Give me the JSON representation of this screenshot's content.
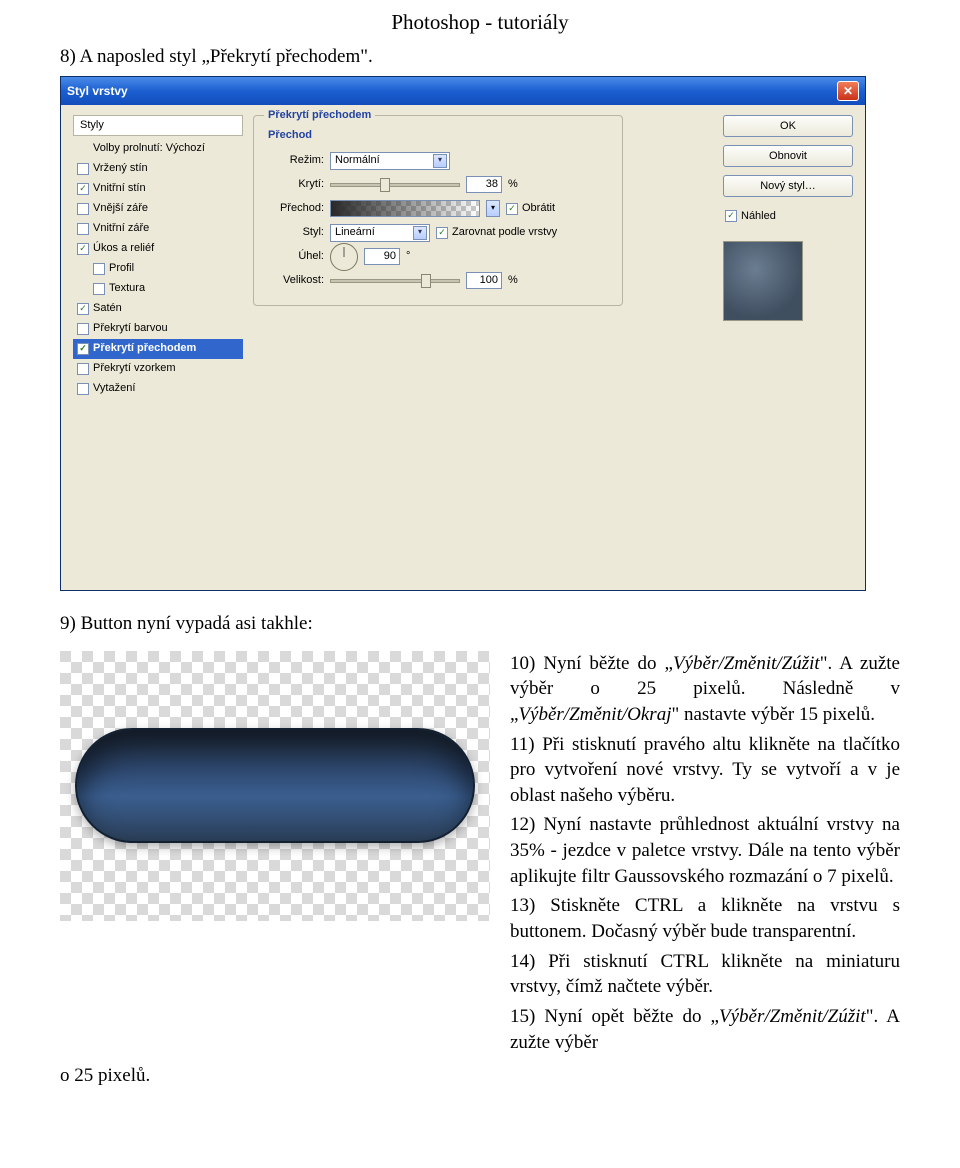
{
  "header": {
    "title": "Photoshop - tutoriály"
  },
  "step8": "8)  A naposled styl „Překrytí přechodem\".",
  "dialog": {
    "title": "Styl vrstvy",
    "left": {
      "header": "Styly",
      "items": [
        {
          "label": "Volby prolnutí: Výchozí",
          "checked": null
        },
        {
          "label": "Vržený stín",
          "checked": false
        },
        {
          "label": "Vnitřní stín",
          "checked": true
        },
        {
          "label": "Vnější záře",
          "checked": false
        },
        {
          "label": "Vnitřní záře",
          "checked": false
        },
        {
          "label": "Úkos a reliéf",
          "checked": true
        },
        {
          "label": "Profil",
          "checked": false,
          "sub": true
        },
        {
          "label": "Textura",
          "checked": false,
          "sub": true
        },
        {
          "label": "Satén",
          "checked": true
        },
        {
          "label": "Překrytí barvou",
          "checked": false
        },
        {
          "label": "Překrytí přechodem",
          "checked": true,
          "selected": true
        },
        {
          "label": "Překrytí vzorkem",
          "checked": false
        },
        {
          "label": "Vytažení",
          "checked": false
        }
      ]
    },
    "mid": {
      "fs_title": "Překrytí přechodem",
      "sub_title": "Přechod",
      "mode_label": "Režim:",
      "mode_value": "Normální",
      "opacity_label": "Krytí:",
      "opacity_value": "38",
      "pct": "%",
      "gradient_label": "Přechod:",
      "invert_label": "Obrátit",
      "style_label": "Styl:",
      "style_value": "Lineární",
      "align_label": "Zarovnat podle vrstvy",
      "angle_label": "Úhel:",
      "angle_value": "90",
      "angle_deg": "°",
      "size_label": "Velikost:",
      "size_value": "100",
      "size_pct": "%"
    },
    "right": {
      "ok": "OK",
      "cancel": "Obnovit",
      "new_style": "Nový styl…",
      "preview_label": "Náhled"
    }
  },
  "step9": "9)  Button nyní vypadá asi takhle:",
  "instr": {
    "p10a": "10) Nyní běžte do „",
    "p10i": "Výběr/Změnit/Zúžit",
    "p10b": "\". A zužte výběr o 25 pixelů. Následně v „",
    "p10i2": "Výběr/Změnit/Okraj",
    "p10c": "\" nastavte výběr 15 pixelů.",
    "p11": "11) Při stisknutí pravého altu klikněte na tlačítko pro vytvoření nové vrstvy. Ty se vytvoří a v je oblast našeho výběru.",
    "p12": "12) Nyní nastavte průhlednost aktuální vrstvy na 35% - jezdce v paletce vrstvy. Dále na tento výběr aplikujte filtr Gaussovského rozmazání o 7 pixelů.",
    "p13": "13) Stiskněte CTRL a klikněte na vrstvu s buttonem. Dočasný výběr bude transparentní.",
    "p14": "14) Při stisknutí CTRL klikněte na miniaturu vrstvy, čímž načtete výběr.",
    "p15a": "15) Nyní    opět    běžte    do „",
    "p15i": "Výběr/Změnit/Zúžit",
    "p15b": "\".  A  zužte  výběr"
  },
  "footer": "o 25 pixelů."
}
